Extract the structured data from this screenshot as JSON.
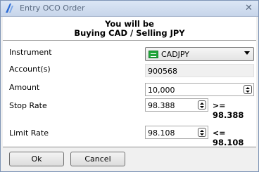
{
  "window": {
    "title": "Entry OCO Order",
    "close_glyph": "✕"
  },
  "header": {
    "line1": "You will be",
    "line2": "Buying CAD / Selling JPY"
  },
  "form": {
    "instrument": {
      "label": "Instrument",
      "value": "CADJPY"
    },
    "account": {
      "label": "Account(s)",
      "value": "900568"
    },
    "amount": {
      "label": "Amount",
      "value": "10,000"
    },
    "stop_rate": {
      "label": "Stop Rate",
      "value": "98.388",
      "op": ">=",
      "bound": "98.388"
    },
    "limit_rate": {
      "label": "Limit Rate",
      "value": "98.108",
      "op": "<=",
      "bound": "98.108"
    }
  },
  "buttons": {
    "ok": "Ok",
    "cancel": "Cancel"
  }
}
